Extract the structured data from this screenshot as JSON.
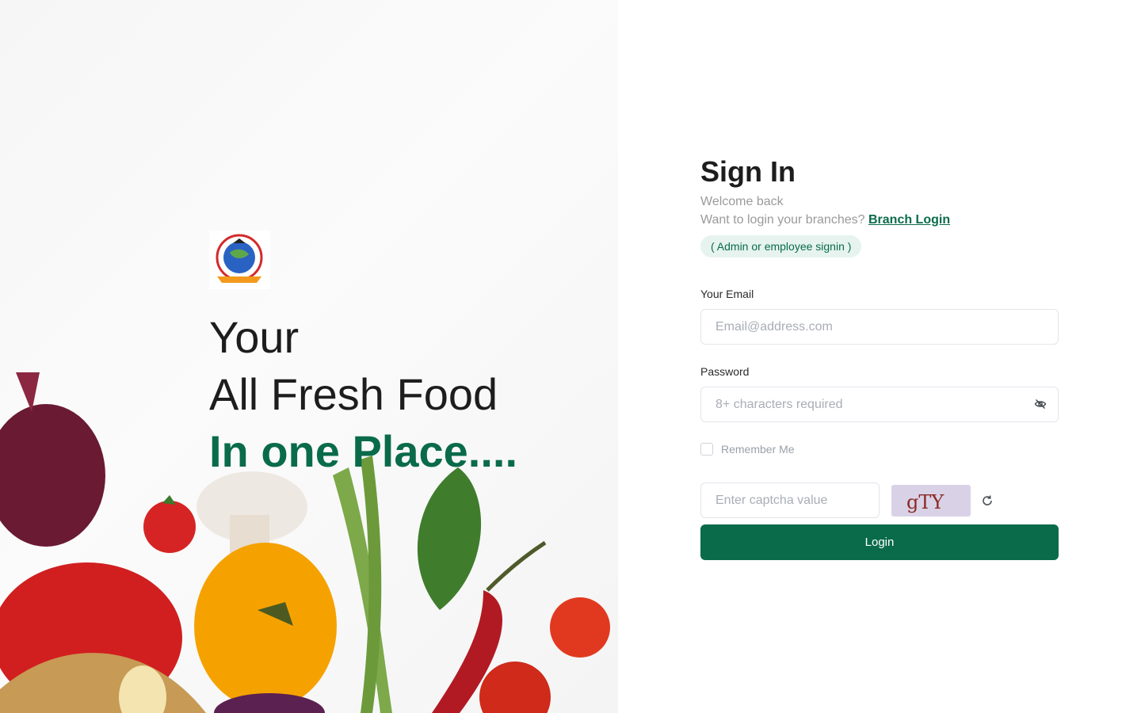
{
  "hero": {
    "line1": "Your",
    "line2": "All Fresh Food",
    "line3": "In one Place...."
  },
  "form": {
    "title": "Sign In",
    "welcome": "Welcome back",
    "branch_prompt": "Want to login your branches?",
    "branch_link": "Branch Login",
    "badge": "( Admin or employee signin )",
    "email_label": "Your Email",
    "email_placeholder": "Email@address.com",
    "password_label": "Password",
    "password_placeholder": "8+ characters required",
    "remember_label": "Remember Me",
    "captcha_placeholder": "Enter captcha value",
    "captcha_text": "gTY",
    "login_label": "Login"
  },
  "colors": {
    "brand": "#0a6b4a",
    "badge_bg": "#e6f3ee",
    "captcha_bg": "#d9d2e7"
  },
  "icons": {
    "password_toggle": "eye-off-icon",
    "captcha_refresh": "refresh-icon"
  }
}
